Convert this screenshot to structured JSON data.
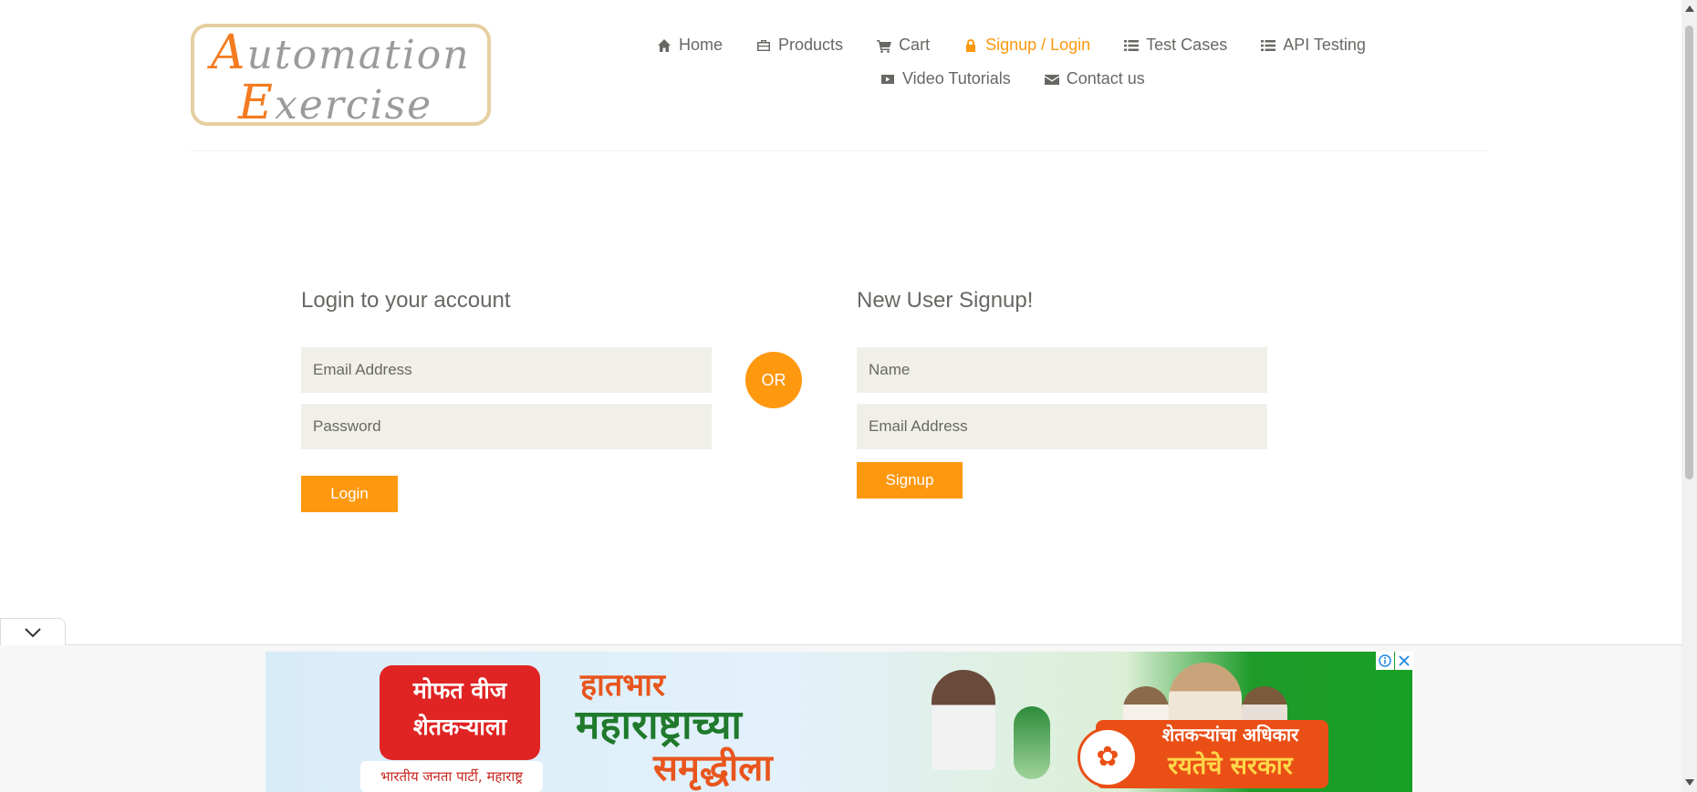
{
  "logo": {
    "line1_cap": "A",
    "line1_rest": "utomation",
    "line2_cap": "E",
    "line2_rest": "xercise"
  },
  "nav": {
    "row1": [
      {
        "label": "Home",
        "icon": "home-icon",
        "active": false
      },
      {
        "label": "Products",
        "icon": "briefcase-icon",
        "active": false
      },
      {
        "label": "Cart",
        "icon": "cart-icon",
        "active": false
      },
      {
        "label": "Signup / Login",
        "icon": "lock-icon",
        "active": true
      },
      {
        "label": "Test Cases",
        "icon": "list-icon",
        "active": false
      },
      {
        "label": "API Testing",
        "icon": "list-icon",
        "active": false
      }
    ],
    "row2": [
      {
        "label": "Video Tutorials",
        "icon": "youtube-play-icon",
        "active": false
      },
      {
        "label": "Contact us",
        "icon": "envelope-icon",
        "active": false
      }
    ]
  },
  "login": {
    "title": "Login to your account",
    "email_placeholder": "Email Address",
    "password_placeholder": "Password",
    "button": "Login"
  },
  "or_label": "OR",
  "signup": {
    "title": "New User Signup!",
    "name_placeholder": "Name",
    "email_placeholder": "Email Address",
    "button": "Signup"
  },
  "ad": {
    "red_box_line1": "मोफत वीज",
    "red_box_line2": "शेतकऱ्याला",
    "strip_text": "भारतीय जनता पार्टी, महाराष्ट्र",
    "headline1": "हातभार",
    "headline2": "महाराष्ट्राच्या",
    "headline3": "समृद्धीला",
    "orange_line1": "शेतकऱ्यांचा अधिकार",
    "orange_line2": "रयतेचे सरकार"
  },
  "colors": {
    "accent": "#fe980f",
    "text": "#696763",
    "input_bg": "#f0f0e9"
  }
}
